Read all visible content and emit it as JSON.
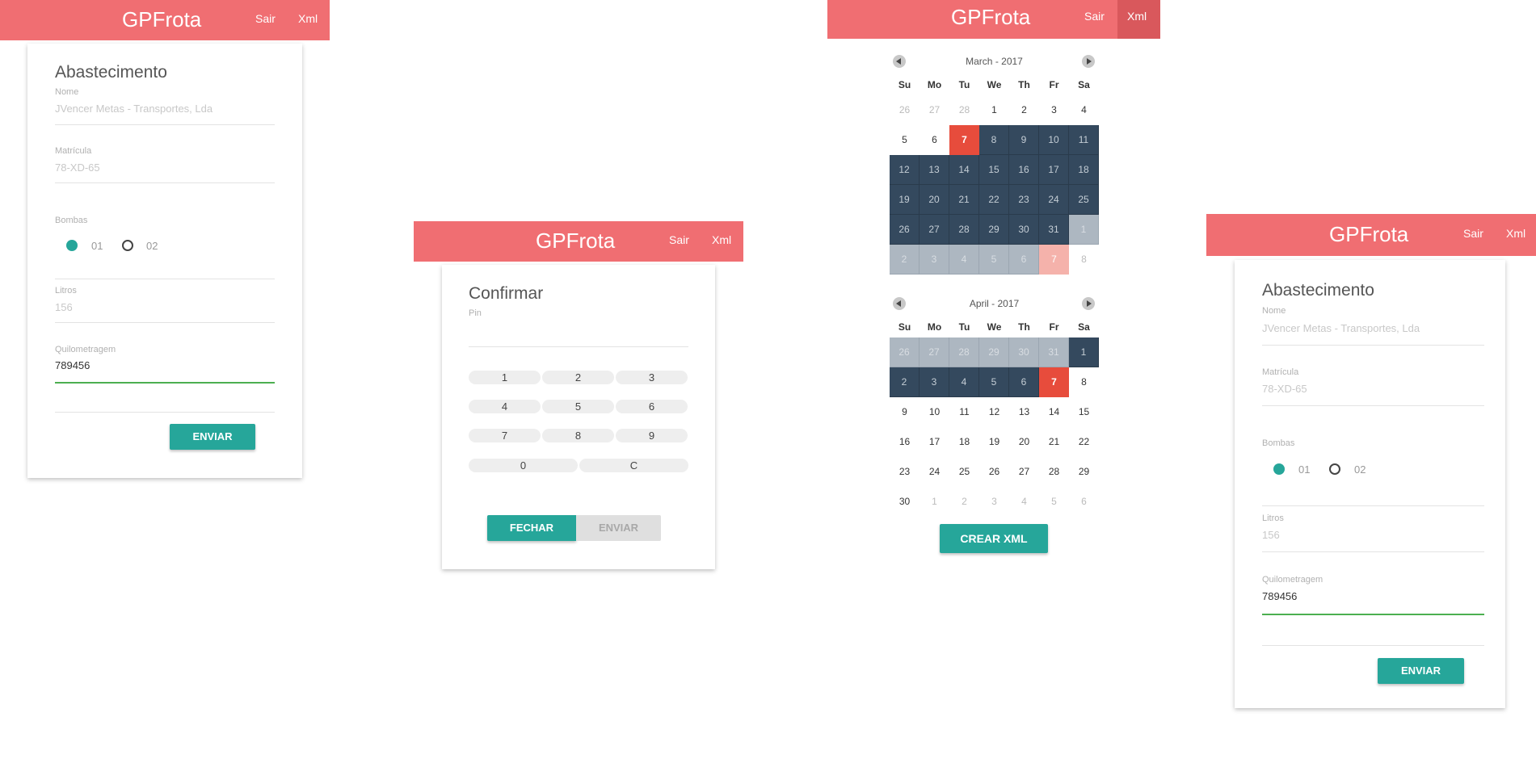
{
  "app": {
    "brand": "GPFrota",
    "nav_sair": "Sair",
    "nav_xml": "Xml"
  },
  "form": {
    "title": "Abastecimento",
    "nome_label": "Nome",
    "nome_value": "JVencer Metas - Transportes, Lda",
    "matricula_label": "Matrícula",
    "matricula_value": "78-XD-65",
    "bombas_label": "Bombas",
    "bomba_options": [
      "01",
      "02"
    ],
    "bomba_selected": "01",
    "litros_label": "Litros",
    "litros_value": "156",
    "km_label": "Quilometragem",
    "km_value": "789456",
    "submit_label": "ENVIAR"
  },
  "confirm": {
    "title": "Confirmar",
    "pin_label": "Pin",
    "pin_value": "",
    "keys": [
      "1",
      "2",
      "3",
      "4",
      "5",
      "6",
      "7",
      "8",
      "9",
      "0",
      "C"
    ],
    "close_label": "FECHAR",
    "send_label": "ENVIAR"
  },
  "calendar": {
    "weekdays": [
      "Su",
      "Mo",
      "Tu",
      "We",
      "Th",
      "Fr",
      "Sa"
    ],
    "months": [
      {
        "header": "March - 2017",
        "weeks": [
          [
            "26",
            "27",
            "28",
            "1",
            "2",
            "3",
            "4"
          ],
          [
            "5",
            "6",
            "7",
            "8",
            "9",
            "10",
            "11"
          ],
          [
            "12",
            "13",
            "14",
            "15",
            "16",
            "17",
            "18"
          ],
          [
            "19",
            "20",
            "21",
            "22",
            "23",
            "24",
            "25"
          ],
          [
            "26",
            "27",
            "28",
            "29",
            "30",
            "31",
            "1"
          ],
          [
            "2",
            "3",
            "4",
            "5",
            "6",
            "7",
            "8"
          ]
        ],
        "states": [
          [
            "other",
            "other",
            "other",
            "cur",
            "cur",
            "cur",
            "cur"
          ],
          [
            "cur",
            "cur",
            "today",
            "sel",
            "sel",
            "sel",
            "sel"
          ],
          [
            "sel",
            "sel",
            "sel",
            "sel",
            "sel",
            "sel",
            "sel"
          ],
          [
            "sel",
            "sel",
            "sel",
            "sel",
            "sel",
            "sel",
            "sel"
          ],
          [
            "sel",
            "sel",
            "sel",
            "sel",
            "sel",
            "sel",
            "selother"
          ],
          [
            "selother",
            "selother",
            "selother",
            "selother",
            "selother",
            "todayother",
            "other"
          ]
        ]
      },
      {
        "header": "April - 2017",
        "weeks": [
          [
            "26",
            "27",
            "28",
            "29",
            "30",
            "31",
            "1"
          ],
          [
            "2",
            "3",
            "4",
            "5",
            "6",
            "7",
            "8"
          ],
          [
            "9",
            "10",
            "11",
            "12",
            "13",
            "14",
            "15"
          ],
          [
            "16",
            "17",
            "18",
            "19",
            "20",
            "21",
            "22"
          ],
          [
            "23",
            "24",
            "25",
            "26",
            "27",
            "28",
            "29"
          ],
          [
            "30",
            "1",
            "2",
            "3",
            "4",
            "5",
            "6"
          ]
        ],
        "states": [
          [
            "selother",
            "selother",
            "selother",
            "selother",
            "selother",
            "selother",
            "sel"
          ],
          [
            "sel",
            "sel",
            "sel",
            "sel",
            "sel",
            "today",
            "cur"
          ],
          [
            "cur",
            "cur",
            "cur",
            "cur",
            "cur",
            "cur",
            "cur"
          ],
          [
            "cur",
            "cur",
            "cur",
            "cur",
            "cur",
            "cur",
            "cur"
          ],
          [
            "cur",
            "cur",
            "cur",
            "cur",
            "cur",
            "cur",
            "cur"
          ],
          [
            "cur",
            "other",
            "other",
            "other",
            "other",
            "other",
            "other"
          ]
        ]
      }
    ],
    "create_label": "CREAR XML"
  },
  "colors": {
    "appbar": "#f06e72",
    "accent": "#26a69a",
    "selected_range": "#34495e",
    "today": "#e74c3c"
  }
}
